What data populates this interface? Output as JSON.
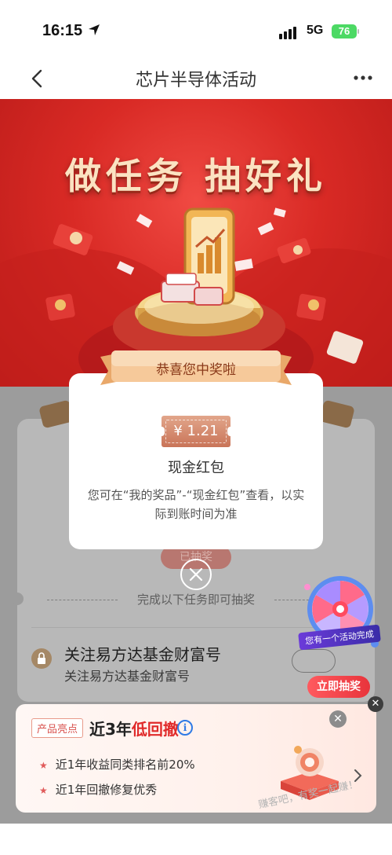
{
  "status_bar": {
    "time": "16:15",
    "network": "5G",
    "battery": "76"
  },
  "nav": {
    "title": "芯片半导体活动"
  },
  "banner": {
    "headline": "做任务 抽好礼"
  },
  "popup": {
    "header": "恭喜您中奖啦",
    "amount": "¥ 1.21",
    "prize_name": "现金红包",
    "description": "您可在“我的奖品”-“现金红包”查看，以实际到账时间为准"
  },
  "background": {
    "drawn_button": "已抽奖",
    "task_hint": "完成以下任务即可抽奖",
    "task_title": "关注易方达基金财富号",
    "task_subtitle": "关注易方达基金财富号"
  },
  "wheel": {
    "tag": "您有一个活动完成",
    "button": "立即抽奖"
  },
  "product_card": {
    "badge": "产品亮点",
    "heading_prefix": "近3年",
    "heading_highlight": "低回撤",
    "features": [
      "近1年收益同类排名前20%",
      "近1年回撤修复优秀"
    ]
  },
  "watermark": "赚客吧，有奖一起赚！"
}
